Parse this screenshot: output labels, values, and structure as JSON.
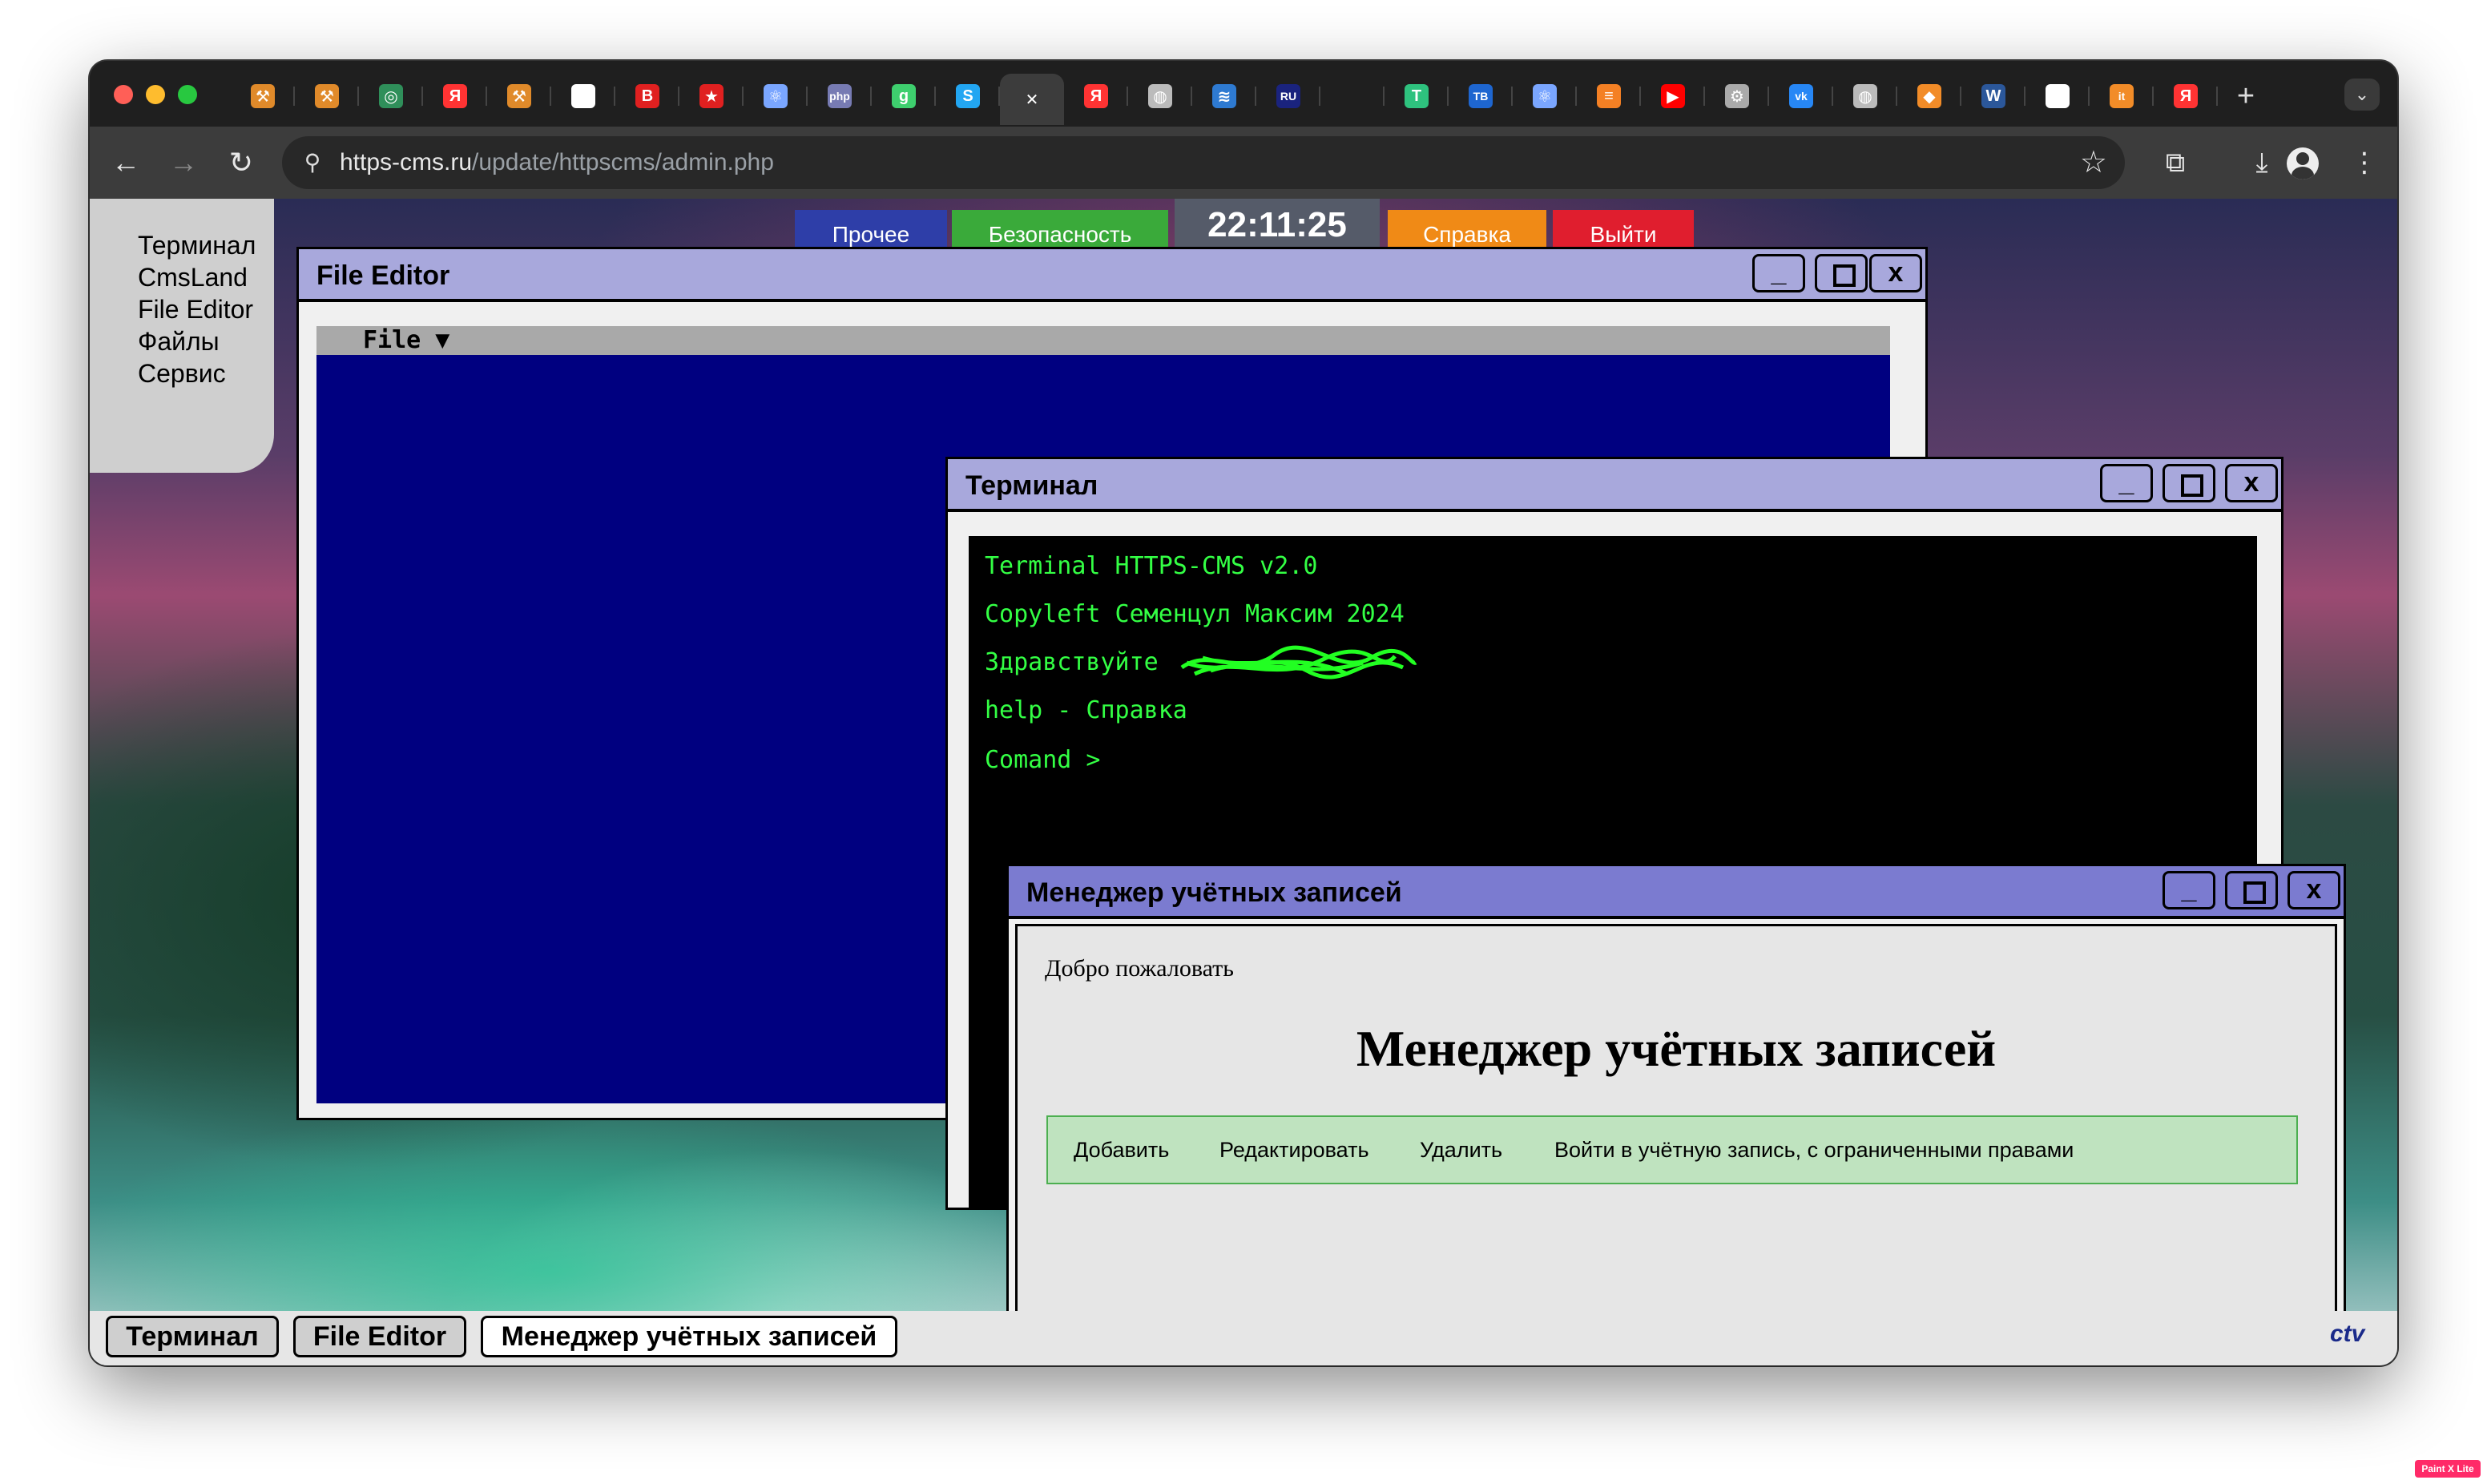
{
  "browser": {
    "tabs": [
      {
        "icon": "hammer-icon",
        "glyph": "⚒",
        "color": "#e08a2a"
      },
      {
        "icon": "hammer-icon",
        "glyph": "⚒",
        "color": "#e08a2a"
      },
      {
        "icon": "green-app-icon",
        "glyph": "◎",
        "color": "#2f8f5a"
      },
      {
        "icon": "yandex-icon",
        "glyph": "Я",
        "color": "#f33"
      },
      {
        "icon": "hammer-icon",
        "glyph": "⚒",
        "color": "#e08a2a"
      },
      {
        "icon": "sparkle-icon",
        "glyph": "✦",
        "color": "#ffffff"
      },
      {
        "icon": "b-icon",
        "glyph": "B",
        "color": "#e02020"
      },
      {
        "icon": "star-icon",
        "glyph": "★",
        "color": "#e02020"
      },
      {
        "icon": "molecule-icon",
        "glyph": "⚛",
        "color": "#7aa6ff"
      },
      {
        "icon": "php-icon",
        "glyph": "php",
        "color": "#777bb3"
      },
      {
        "icon": "g-icon",
        "glyph": "ɡ",
        "color": "#3ecf6e"
      },
      {
        "icon": "s-icon",
        "glyph": "S",
        "color": "#22a6f2"
      },
      {
        "icon": "close-icon",
        "glyph": "✕",
        "color": "#ffffff",
        "active": true
      },
      {
        "icon": "yandex-icon",
        "glyph": "Я",
        "color": "#f33"
      },
      {
        "icon": "globe-icon",
        "glyph": "◍",
        "color": "#bbbbbb"
      },
      {
        "icon": "stack-icon",
        "glyph": "≋",
        "color": "#2e7ad1"
      },
      {
        "icon": "ru-icon",
        "glyph": "RU",
        "color": "#1a237e"
      },
      {
        "icon": "blank-icon",
        "glyph": "",
        "color": "#222"
      },
      {
        "icon": "t-icon",
        "glyph": "T",
        "color": "#2ec27e"
      },
      {
        "icon": "tb-icon",
        "glyph": "TB",
        "color": "#1e66d0"
      },
      {
        "icon": "molecule-icon",
        "glyph": "⚛",
        "color": "#7aa6ff"
      },
      {
        "icon": "stackoverflow-icon",
        "glyph": "≡",
        "color": "#f48024"
      },
      {
        "icon": "youtube-icon",
        "glyph": "▶",
        "color": "#ff0000"
      },
      {
        "icon": "gear-icon",
        "glyph": "⚙",
        "color": "#aaaaaa"
      },
      {
        "icon": "vk-icon",
        "glyph": "vk",
        "color": "#2787f5"
      },
      {
        "icon": "globe-icon",
        "glyph": "◍",
        "color": "#bbbbbb"
      },
      {
        "icon": "diamond-icon",
        "glyph": "◆",
        "color": "#f28c28"
      },
      {
        "icon": "word-icon",
        "glyph": "W",
        "color": "#2b579a"
      },
      {
        "icon": "doc-icon",
        "glyph": "✎",
        "color": "#ffffff"
      },
      {
        "icon": "orange-circle-icon",
        "glyph": "it",
        "color": "#f28c28"
      },
      {
        "icon": "yandex-icon",
        "glyph": "Я",
        "color": "#f33"
      }
    ],
    "url_host": "https-cms.ru",
    "url_path": "/update/httpscms/admin.php"
  },
  "left_menu": {
    "items": [
      "Терминал",
      "CmsLand",
      "File Editor",
      "Файлы",
      "Сервис"
    ]
  },
  "top_menu": {
    "buttons": [
      {
        "label": "Прочее",
        "color": "#2e3ea8"
      },
      {
        "label": "Безопасность",
        "color": "#3aaa3a"
      },
      {
        "label": "Справка",
        "color": "#f08a16"
      },
      {
        "label": "Выйти",
        "color": "#e01e2e"
      }
    ],
    "clock": "22:11:25"
  },
  "file_editor": {
    "title": "File Editor",
    "menu_label": "File ▼"
  },
  "terminal": {
    "title": "Терминал",
    "lines": [
      "Terminal HTTPS-CMS v2.0",
      "Copyleft Семенцул Максим 2024",
      "Здравствуйте",
      "help - Справка",
      "Comand >"
    ]
  },
  "account_manager": {
    "title": "Менеджер учётных записей",
    "welcome": "Добро пожаловать",
    "heading": "Менеджер учётных записей",
    "actions": [
      "Добавить",
      "Редактировать",
      "Удалить",
      "Войти в учётную запись, с ограниченными правами"
    ]
  },
  "window_controls": {
    "minimize": "_",
    "close": "x"
  },
  "taskbar": {
    "items": [
      "Терминал",
      "File Editor",
      "Менеджер учётных записей"
    ],
    "right_text": "ctv"
  },
  "badge": "Paint X Lite"
}
